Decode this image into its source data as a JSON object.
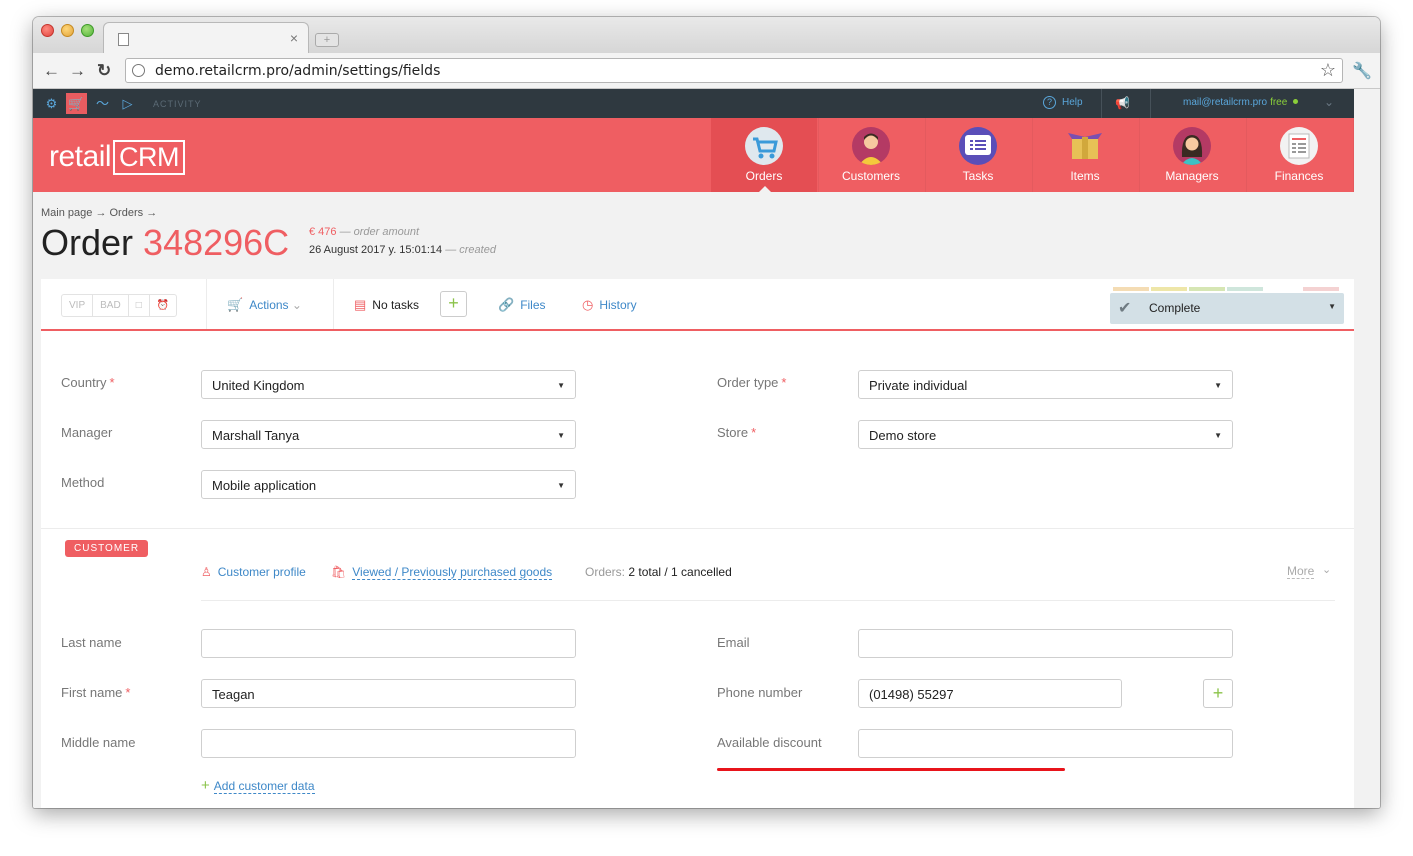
{
  "browser": {
    "url": "demo.retailcrm.pro/admin/settings/fields",
    "tab_close": "×",
    "new_tab": "+"
  },
  "topbar": {
    "activity_label": "ACTIVITY",
    "help_label": "Help",
    "user_email": "mail@retailcrm.pro",
    "plan": "free"
  },
  "logo": {
    "text_left": "retail",
    "text_right": "CRM"
  },
  "nav": {
    "items": [
      {
        "label": "Orders",
        "icon": "cart-icon",
        "active": true
      },
      {
        "label": "Customers",
        "icon": "customer-avatar-icon",
        "active": false
      },
      {
        "label": "Tasks",
        "icon": "tasks-list-icon",
        "active": false
      },
      {
        "label": "Items",
        "icon": "box-icon",
        "active": false
      },
      {
        "label": "Managers",
        "icon": "manager-avatar-icon",
        "active": false
      },
      {
        "label": "Finances",
        "icon": "finances-sheet-icon",
        "active": false
      }
    ]
  },
  "breadcrumb": {
    "main": "Main page",
    "orders": "Orders",
    "arrow": "→"
  },
  "order": {
    "title": "Order",
    "number": "348296C",
    "amount": "€ 476",
    "amount_label": "— order amount",
    "created": "26 August 2017 y. 15:01:14",
    "created_label": "— created"
  },
  "actionbar": {
    "tags": [
      "VIP",
      "BAD",
      "□",
      "⏰"
    ],
    "actions_label": "Actions",
    "tasks_label": "No tasks",
    "add_task": "+",
    "files_label": "Files",
    "history_label": "History",
    "status_label": "Complete",
    "status_stripe_colors": [
      "#f4dcb4",
      "#eee6a8",
      "#d6e6b4",
      "#cfe6dc",
      "#ffffff",
      "#f4d2d2"
    ]
  },
  "order_fields": {
    "country": {
      "label": "Country",
      "value": "United Kingdom",
      "required": "*"
    },
    "manager": {
      "label": "Manager",
      "value": "Marshall Tanya"
    },
    "method": {
      "label": "Method",
      "value": "Mobile application"
    },
    "order_type": {
      "label": "Order type",
      "value": "Private individual",
      "required": "*"
    },
    "store": {
      "label": "Store",
      "value": "Demo store",
      "required": "*"
    }
  },
  "customer": {
    "badge": "CUSTOMER",
    "profile_link": "Customer profile",
    "viewed_link": "Viewed / Previously purchased goods",
    "orders_label": "Orders:",
    "orders_value": "2 total / 1 cancelled",
    "more_label": "More",
    "last_name": {
      "label": "Last name",
      "value": ""
    },
    "first_name": {
      "label": "First name",
      "value": "Teagan",
      "required": "*"
    },
    "middle_name": {
      "label": "Middle name",
      "value": ""
    },
    "email": {
      "label": "Email",
      "value": ""
    },
    "phone": {
      "label": "Phone number",
      "value": "(01498) 55297"
    },
    "discount": {
      "label": "Available discount",
      "value": ""
    },
    "add_phone": "+",
    "add_data": "Add customer data"
  },
  "colors": {
    "brand": "#ef5e62",
    "link": "#3e88c8",
    "accent_green": "#8bc34a",
    "highlight": "#e8141b"
  }
}
